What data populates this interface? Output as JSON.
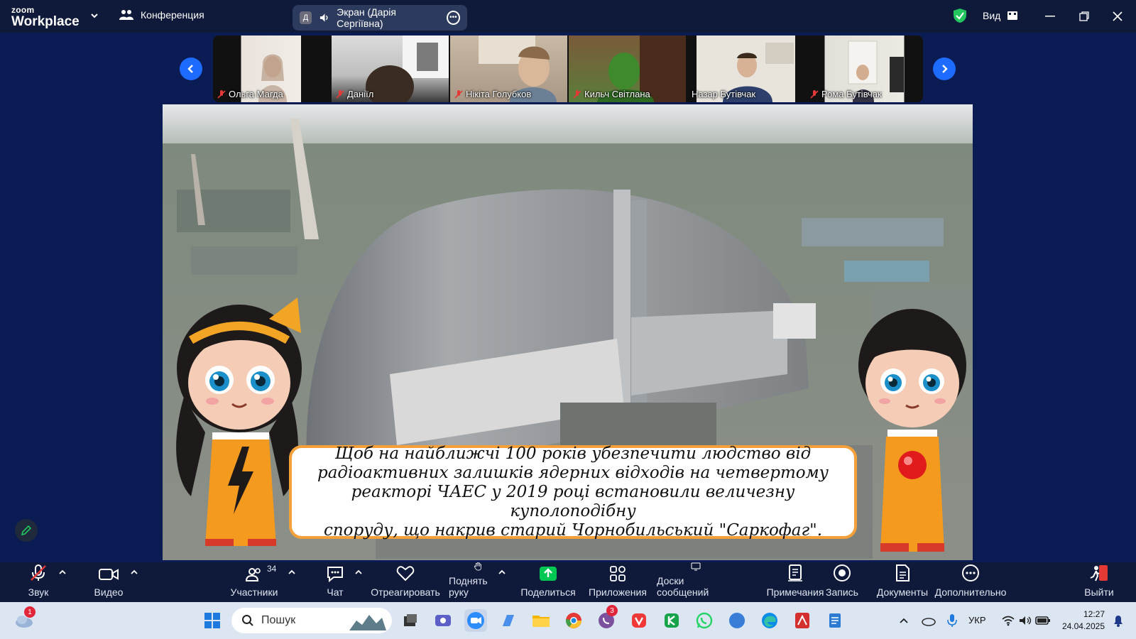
{
  "titlebar": {
    "brand_top": "zoom",
    "brand_bottom": "Workplace",
    "meeting_label": "Конференция",
    "share_initial": "Д",
    "share_label": "Экран (Дарія Сергіївна)",
    "view_label": "Вид"
  },
  "participants": [
    {
      "name": "Ольга Магда",
      "muted": true
    },
    {
      "name": "Даніїл",
      "muted": true
    },
    {
      "name": "Нікіта Голубков",
      "muted": true
    },
    {
      "name": "Кильч  Світлана",
      "muted": true
    },
    {
      "name": "Назар Бутівчак",
      "muted": false
    },
    {
      "name": "Рома Бутівчак",
      "muted": true
    }
  ],
  "slide": {
    "caption_line1": "Щоб на найближчі 100 років убезпечити людство від",
    "caption_line2": "радіоактивних залишків ядерних відходів на четвертому",
    "caption_line3": "реакторі ЧАЕС у 2019 році встановили величезну куполоподібну",
    "caption_line4": "споруду, що накрив старий Чорнобильський \"Саркофаг\"."
  },
  "toolbar": {
    "audio": "Звук",
    "video": "Видео",
    "participants": "Участники",
    "participants_count": "34",
    "chat": "Чат",
    "react": "Отреагировать",
    "raise_hand": "Поднять руку",
    "share": "Поделиться",
    "apps": "Приложения",
    "whiteboards": "Доски сообщений",
    "notes": "Примечания",
    "record": "Запись",
    "docs": "Документы",
    "more": "Дополнительно",
    "leave": "Выйти"
  },
  "taskbar": {
    "search_placeholder": "Пошук",
    "weather_badge": "1",
    "viber_badge": "3",
    "language": "УКР",
    "time": "12:27",
    "date": "24.04.2025"
  },
  "colors": {
    "background": "#0b1b54",
    "bar": "#0f1a3a",
    "accent_blue": "#1e6bff",
    "share_green": "#00c853",
    "caption_border": "#f3a03b"
  }
}
